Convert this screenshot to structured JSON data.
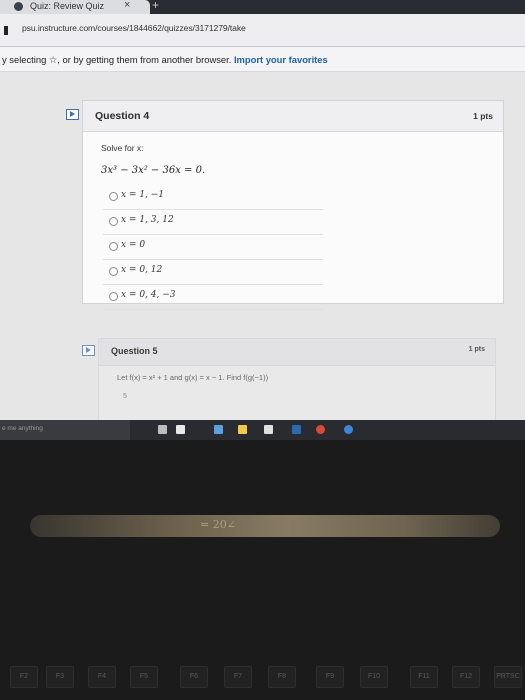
{
  "browser": {
    "tab_title": "Quiz: Review Quiz",
    "url": "psu.instructure.com/courses/1844662/quizzes/3171279/take",
    "favorites_text": "y selecting ☆, or by getting them from another browser.",
    "favorites_link": "Import your favorites"
  },
  "question4": {
    "title": "Question 4",
    "points": "1 pts",
    "prompt": "Solve for x:",
    "equation": "3x³ − 3x² − 36x = 0.",
    "answers": [
      "x = 1, −1",
      "x = 1, 3, 12",
      "x = 0",
      "x = 0, 12",
      "x = 0, 4, −3"
    ]
  },
  "question5": {
    "title": "Question 5",
    "points": "1 pts",
    "body": "Let f(x) = x² + 1 and g(x) = x − 1. Find f(g(−1))",
    "first_option": "5"
  },
  "taskbar": {
    "search_placeholder": "e me anything"
  },
  "photo_artifacts": {
    "hinge_text": "= 20∠"
  },
  "keyboard": {
    "keys": [
      "F2",
      "F3",
      "F4",
      "F5",
      "F6",
      "F7",
      "F8",
      "F9",
      "F10",
      "F11",
      "F12",
      "PRTSC"
    ]
  }
}
